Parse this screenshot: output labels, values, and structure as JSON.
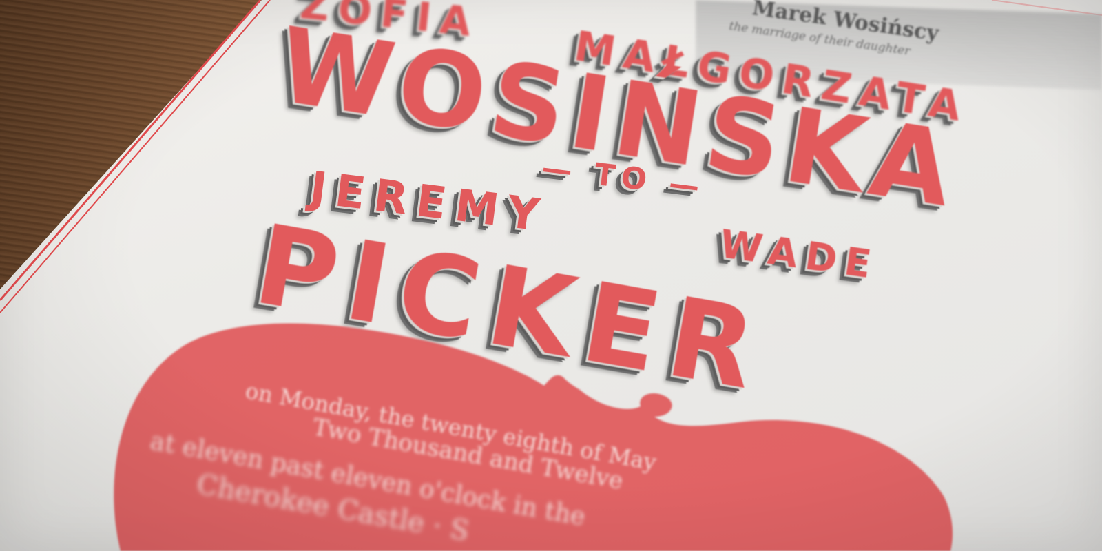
{
  "invitation": {
    "parents_line": "Marek Wosińscy",
    "parents_subline": "the marriage of their daughter",
    "bride_first": "ZOFIA",
    "bride_middle": "MAŁGORZATA",
    "bride_last": "WOSIŃSKA",
    "connector": "— TO —",
    "groom_first": "JEREMY",
    "groom_middle": "WADE",
    "groom_last": "PICKER",
    "details": [
      "on Monday, the twenty eighth of May",
      "Two Thousand and Twelve",
      "at eleven past eleven o'clock in the",
      "Cherokee Castle · S"
    ]
  },
  "colors": {
    "marquee_red": "#e25a5c",
    "shadow_gray": "#5c5c5c",
    "paper": "#f0efec",
    "border_red": "#e0484a",
    "blob_red": "#e0585a",
    "wood": "#6b4428"
  },
  "scene": {
    "surface": "wooden-table",
    "object": "printed-wedding-invitation"
  }
}
